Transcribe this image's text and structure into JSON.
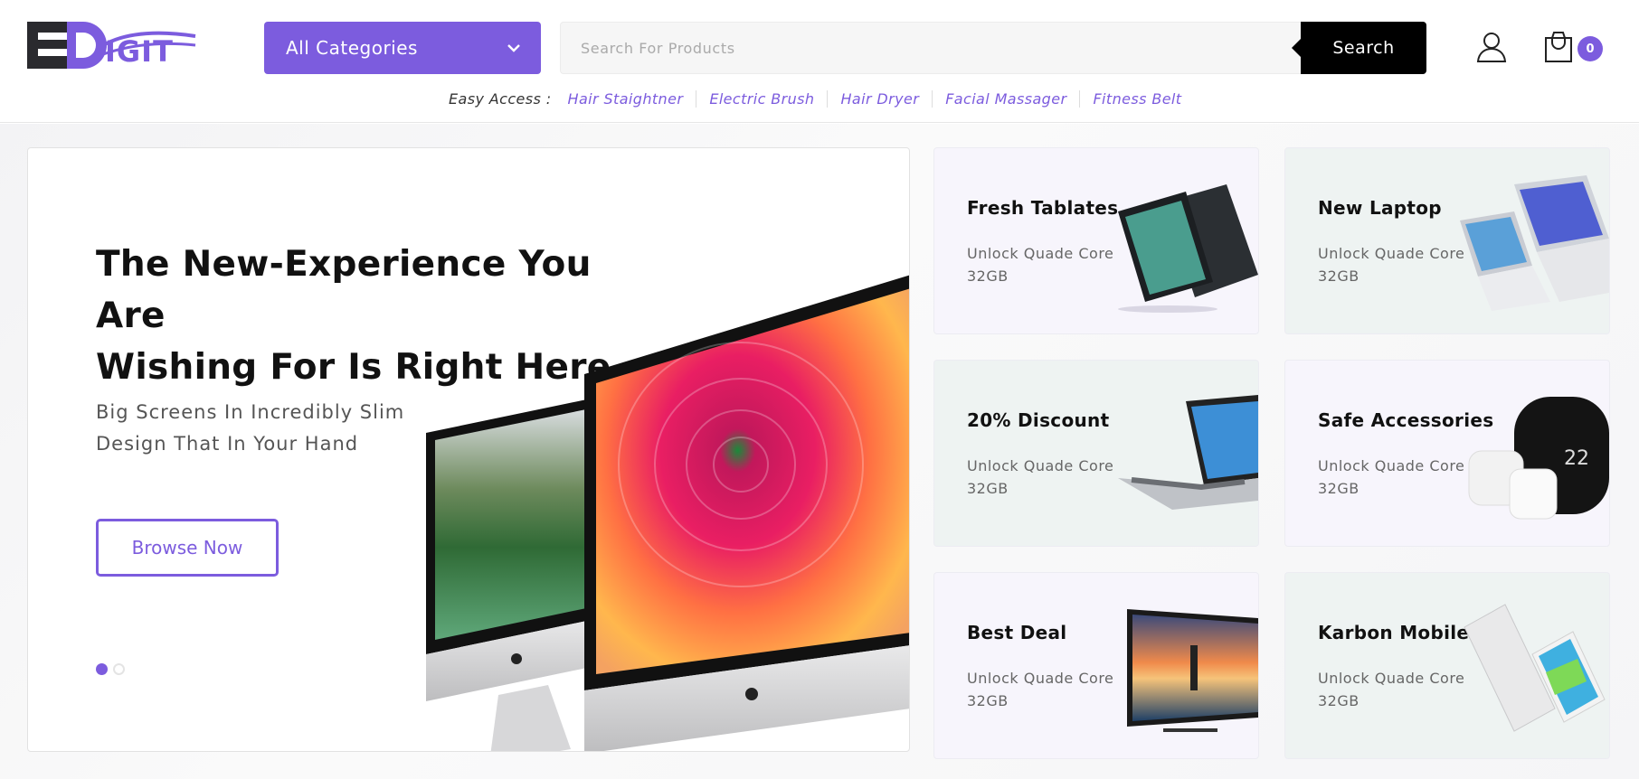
{
  "brand": {
    "logo_text": "EDIGIT",
    "accent_color": "#7c5cde"
  },
  "header": {
    "category_select": {
      "selected": "All Categories"
    },
    "search": {
      "placeholder": "Search For Products",
      "button_label": "Search"
    },
    "cart": {
      "count": "0"
    },
    "icons": {
      "account": "user-icon",
      "cart": "shopping-bag-icon",
      "dropdown": "chevron-down-icon"
    }
  },
  "easy_access": {
    "label": "Easy Access :",
    "links": [
      "Hair Staightner",
      "Electric Brush",
      "Hair Dryer",
      "Facial Massager",
      "Fitness Belt"
    ]
  },
  "hero": {
    "title_line1": "The New-Experience You Are",
    "title_line2": "Wishing For Is Right Here",
    "subtitle_line1": "Big Screens In Incredibly Slim",
    "subtitle_line2": "Design That In Your Hand",
    "button_label": "Browse Now",
    "slides_total": 2,
    "active_slide": 1
  },
  "promo_cards": [
    {
      "title": "Fresh Tablates",
      "line1": "Unlock Quade Core",
      "line2": "32GB",
      "theme": "lavender",
      "image": "tablet"
    },
    {
      "title": "New Laptop",
      "line1": "Unlock Quade Core",
      "line2": "32GB",
      "theme": "mint",
      "image": "laptop"
    },
    {
      "title": "20% Discount",
      "line1": "Unlock Quade Core",
      "line2": "32GB",
      "theme": "mint",
      "image": "tablet-keyboard"
    },
    {
      "title": "Safe Accessories",
      "line1": "Unlock Quade Core",
      "line2": "32GB",
      "theme": "lavender",
      "image": "thermostat"
    },
    {
      "title": "Best Deal",
      "line1": "Unlock Quade Core",
      "line2": "32GB",
      "theme": "lavender",
      "image": "tv"
    },
    {
      "title": "Karbon Mobile",
      "line1": "Unlock Quade Core",
      "line2": "32GB",
      "theme": "mint",
      "image": "phone"
    }
  ]
}
